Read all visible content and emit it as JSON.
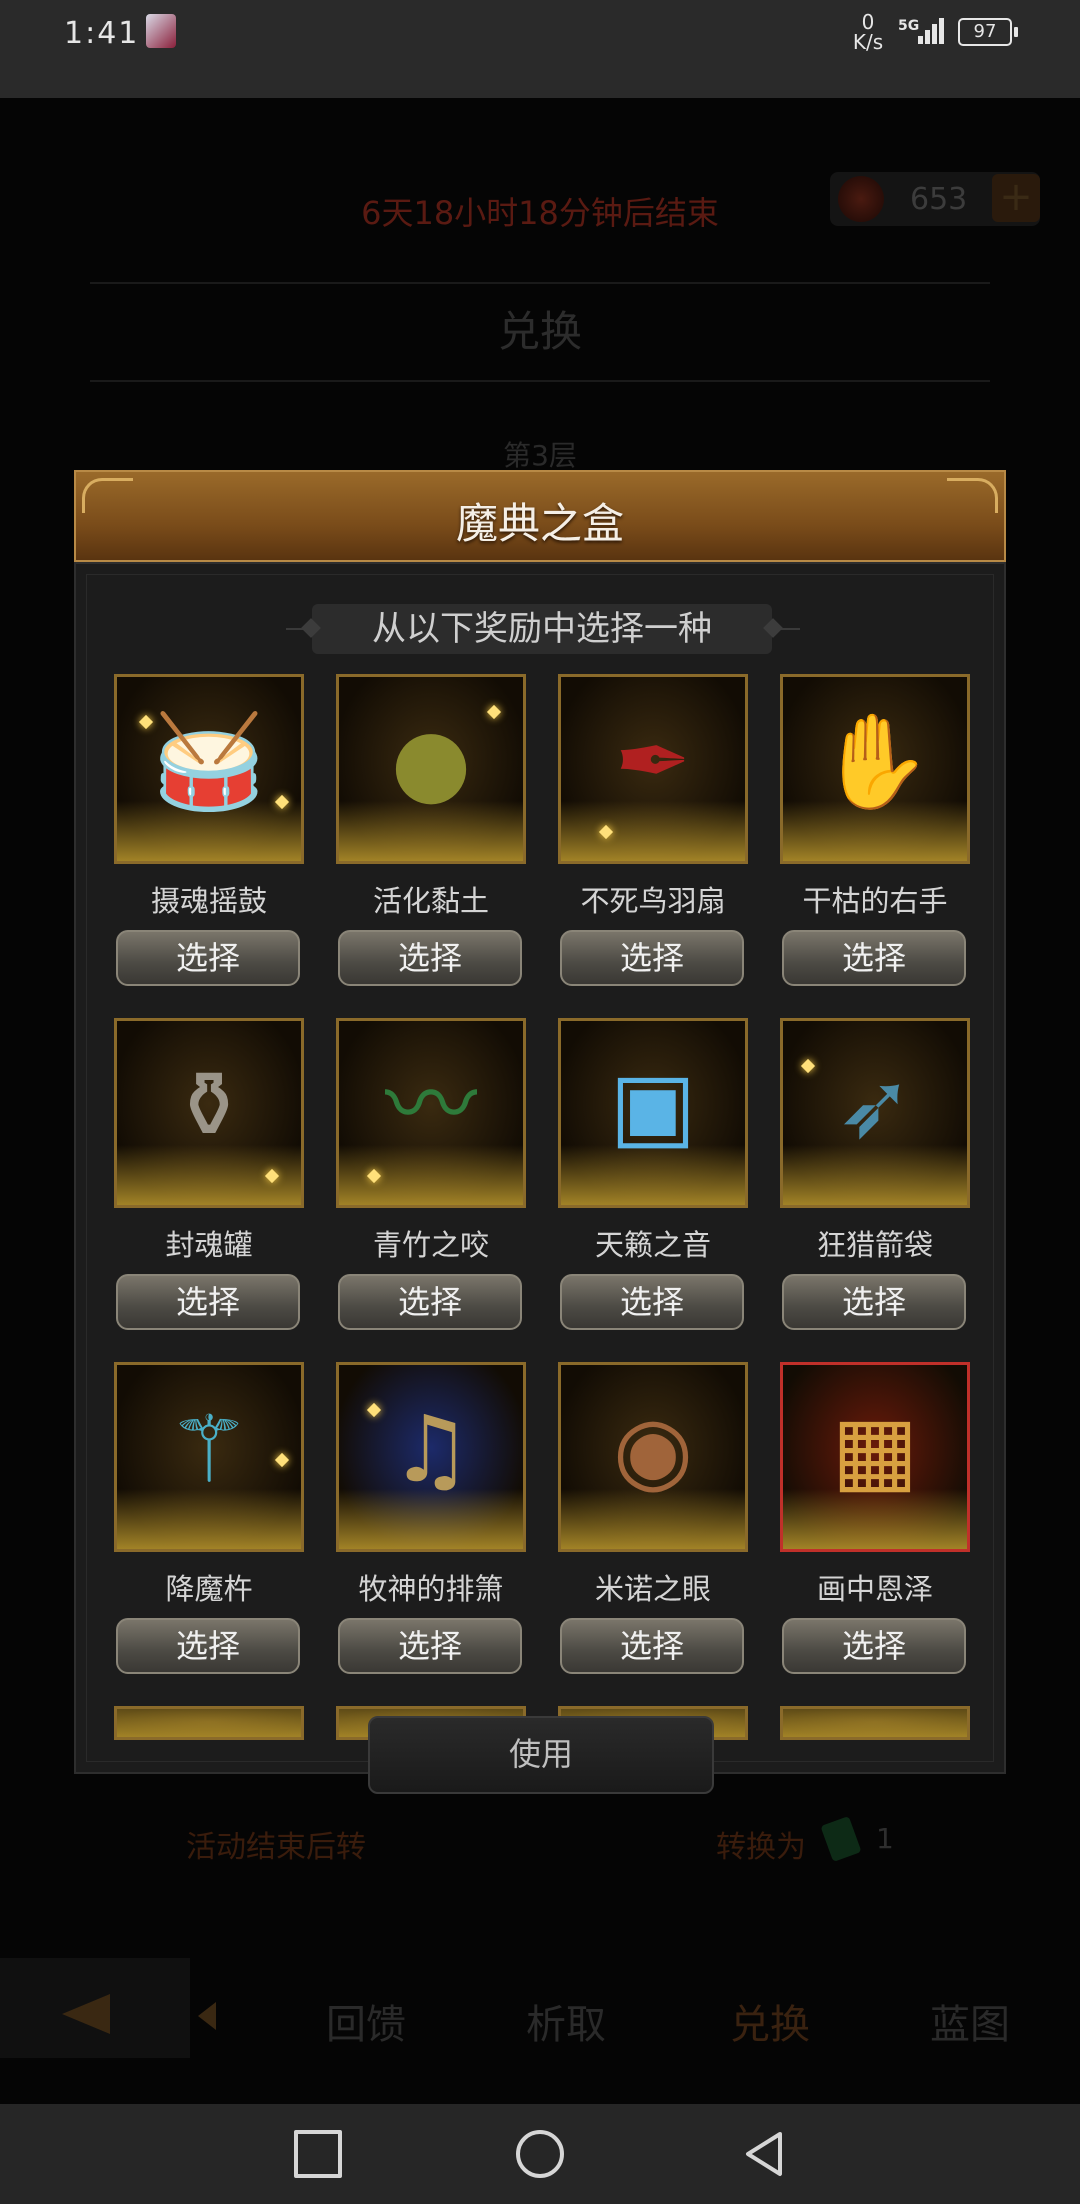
{
  "status_bar": {
    "time": "1:41",
    "net_speed_value": "0",
    "net_speed_unit": "K/s",
    "signal_label": "5G",
    "battery": "97"
  },
  "background": {
    "timer": "6天18小时18分钟后结束",
    "currency_value": "653",
    "currency_plus": "+",
    "title": "兑换",
    "layer_label": "第3层",
    "notice_left": "活动结束后转",
    "notice_right": "转换为",
    "gem_value": "1",
    "use_button": "使用",
    "tabs": [
      "回馈",
      "析取",
      "兑换",
      "蓝图"
    ]
  },
  "modal": {
    "title": "魔典之盒",
    "subtitle": "从以下奖励中选择一种",
    "select_label": "选择",
    "items": [
      {
        "name": "摄魂摇鼓",
        "icon": "drum-icon"
      },
      {
        "name": "活化黏土",
        "icon": "clay-icon"
      },
      {
        "name": "不死鸟羽扇",
        "icon": "feather-fan-icon"
      },
      {
        "name": "干枯的右手",
        "icon": "withered-hand-icon"
      },
      {
        "name": "封魂罐",
        "icon": "urn-icon"
      },
      {
        "name": "青竹之咬",
        "icon": "whip-icon"
      },
      {
        "name": "天籁之音",
        "icon": "music-box-icon"
      },
      {
        "name": "狂猎箭袋",
        "icon": "quiver-icon"
      },
      {
        "name": "降魔杵",
        "icon": "vajra-icon"
      },
      {
        "name": "牧神的排箫",
        "icon": "panflute-icon"
      },
      {
        "name": "米诺之眼",
        "icon": "eye-orb-icon"
      },
      {
        "name": "画中恩泽",
        "icon": "portrait-icon"
      }
    ]
  }
}
